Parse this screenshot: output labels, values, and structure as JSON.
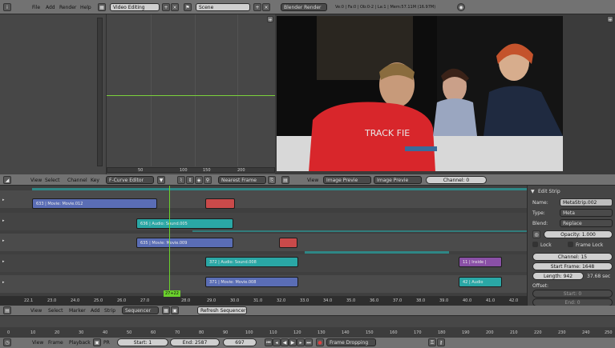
{
  "top_header": {
    "menus": [
      "File",
      "Add",
      "Render",
      "Help"
    ],
    "screen_layout": "Video Editing",
    "scene": "Scene",
    "render_engine": "Blender Render",
    "stats": "Ve:0 | Fa:0 | Ob:0-2 | La:1 | Mem:57.11M (16.97M)"
  },
  "fcurve_panel": {
    "ticks": [
      "50",
      "100",
      "150",
      "200"
    ]
  },
  "fcurve_header": {
    "menus": [
      "View",
      "Select",
      "Channel",
      "Key"
    ],
    "editor_type": "F-Curve Editor",
    "snap": "Nearest Frame"
  },
  "preview_header": {
    "menu": "View",
    "view_type": "Image Previe",
    "display_mode": "Image Previe",
    "channel": "Channel: 0"
  },
  "sequencer": {
    "strips": [
      {
        "label": "633 | Movie: Movie.012",
        "type": "movie"
      },
      {
        "label": "",
        "type": "red"
      },
      {
        "label": "636 | Audio: Sound.005",
        "type": "sound"
      },
      {
        "label": "635 | Movie: Movie.009",
        "type": "movie"
      },
      {
        "label": "",
        "type": "red"
      },
      {
        "label": "372 | Audio: Sound.008",
        "type": "sound"
      },
      {
        "label": "11 | Inside |",
        "type": "meta"
      },
      {
        "label": "371 | Movie: Movie.008",
        "type": "movie"
      },
      {
        "label": "42 | Audio",
        "type": "sound"
      }
    ],
    "timecodes": [
      "22.1",
      "23.0",
      "24.0",
      "25.0",
      "26.0",
      "27.0",
      "28.0",
      "29.0",
      "30.0",
      "31.0",
      "32.0",
      "33.0",
      "34.0",
      "35.0",
      "36.0",
      "37.0",
      "38.0",
      "39.0",
      "40.0",
      "41.0",
      "42.0"
    ],
    "playhead_label": "27+22"
  },
  "sequencer_header": {
    "menus": [
      "View",
      "Select",
      "Marker",
      "Add",
      "Strip"
    ],
    "editor_type": "Sequencer",
    "refresh_button": "Refresh Sequencer"
  },
  "timeline_ruler": {
    "ticks": [
      "0",
      "10",
      "20",
      "30",
      "40",
      "50",
      "60",
      "70",
      "80",
      "90",
      "100",
      "110",
      "120",
      "130",
      "140",
      "150",
      "160",
      "170",
      "180",
      "190",
      "200",
      "210",
      "220",
      "230",
      "240",
      "250"
    ]
  },
  "timeline_header": {
    "menus": [
      "View",
      "Frame",
      "Playback"
    ],
    "pr_label": "PR",
    "start": "Start: 1",
    "end": "End: 2587",
    "current_frame": "697",
    "sync": "Frame Dropping"
  },
  "properties": {
    "panel_title": "Edit Strip",
    "name_label": "Name:",
    "name_value": "MetaStrip.002",
    "type_label": "Type:",
    "type_value": "Meta",
    "blend_label": "Blend:",
    "blend_value": "Replace",
    "opacity": "Opacity: 1.000",
    "lock_label": "Lock",
    "frame_lock_label": "Frame Lock",
    "channel": "Channel: 15",
    "start_frame": "Start Frame: 1648",
    "length": "Length: 942",
    "length_sec": "37.68 sec",
    "offset_label": "Offset:",
    "offset_start": "Start: 0",
    "offset_end": "End: 0"
  }
}
